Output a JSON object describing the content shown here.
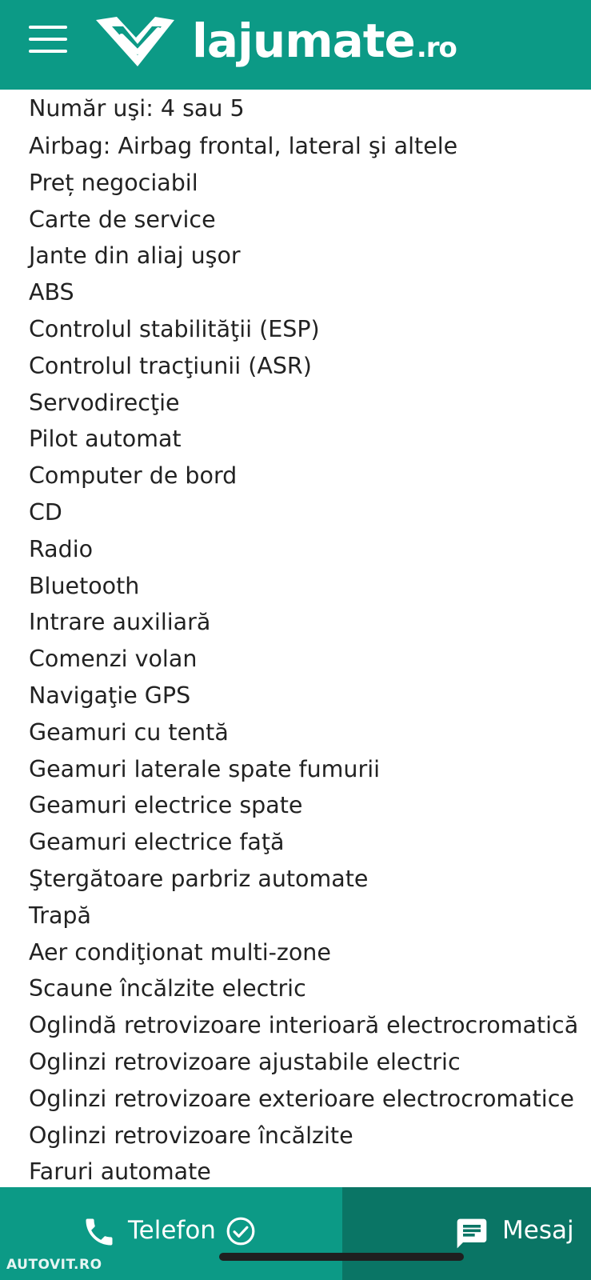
{
  "header": {
    "menu_icon": "hamburger-menu-icon",
    "logo_icon": "handshake-checkmark-logo",
    "logo_text": "lajumate",
    "logo_tld": ".ro",
    "background_color": "#0c9a86"
  },
  "features": [
    "Număr uşi: 4 sau 5",
    "Airbag: Airbag frontal, lateral şi altele",
    "Preț negociabil",
    "Carte de service",
    "Jante din aliaj uşor",
    "ABS",
    "Controlul stabilităţii (ESP)",
    "Controlul tracţiunii (ASR)",
    "Servodirecţie",
    "Pilot automat",
    "Computer de bord",
    "CD",
    "Radio",
    "Bluetooth",
    "Intrare auxiliară",
    "Comenzi volan",
    "Navigaţie GPS",
    "Geamuri cu tentă",
    "Geamuri laterale spate fumurii",
    "Geamuri electrice spate",
    "Geamuri electrice faţă",
    "Ştergătoare parbriz automate",
    "Trapă",
    "Aer condiţionat multi-zone",
    "Scaune încălzite electric",
    "Oglindă retrovizoare interioară electrocromatică",
    "Oglinzi retrovizoare ajustabile electric",
    "Oglinzi retrovizoare exterioare electrocromatice",
    "Oglinzi retrovizoare încălzite",
    "Faruri automate"
  ],
  "bottom_bar": {
    "phone_label": "Telefon",
    "phone_icon": "phone-icon",
    "verified_icon": "check-circle-icon",
    "message_label": "Mesaj",
    "message_icon": "chat-bubble-icon",
    "phone_color": "#0c9a86",
    "message_color": "#0a7565"
  },
  "watermark": "AUTOVIT.RO"
}
